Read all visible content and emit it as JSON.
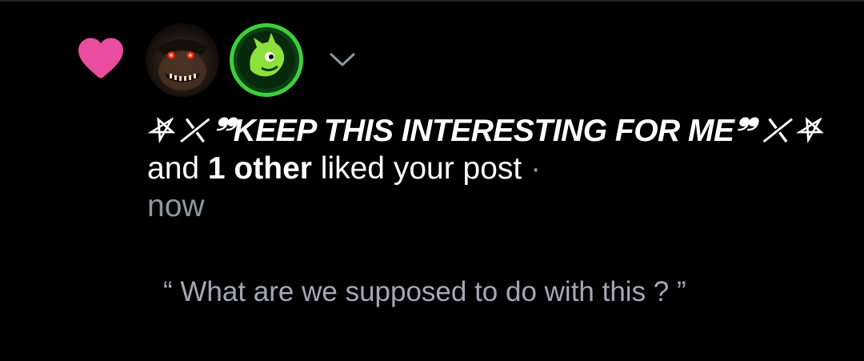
{
  "notification": {
    "type_icon": "heart-icon",
    "accent_color": "#ea4c9f",
    "avatars": [
      {
        "icon": "dark-creature-avatar"
      },
      {
        "icon": "green-mascot-avatar"
      }
    ],
    "expand_icon": "chevron-down-icon",
    "user_name": "⛧ ⤫ ❞KEEP THIS INTERESTING FOR ME❞ ⤫ ⛧",
    "text_and": " and ",
    "others": "1 other",
    "action_text": " liked your post ",
    "separator": "·",
    "timestamp": "now",
    "post_excerpt": "“ What are we supposed to do with this ? ”"
  }
}
